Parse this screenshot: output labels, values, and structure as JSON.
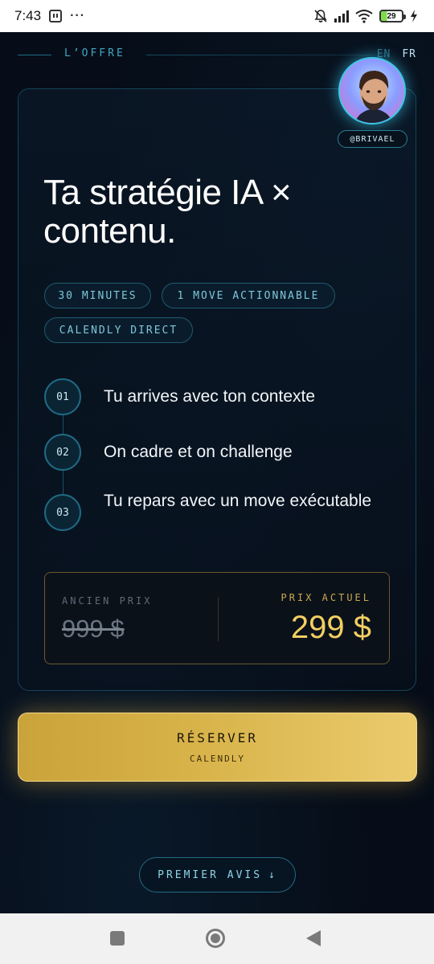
{
  "status_bar": {
    "time": "7:43",
    "dots": "···",
    "battery_level": "29",
    "icons": [
      "twitch-icon",
      "bell-off-icon",
      "signal-icon",
      "wifi-icon",
      "battery-icon",
      "charging-icon"
    ]
  },
  "header": {
    "section_label": "L’OFFRE",
    "lang_en": "EN",
    "lang_fr": "FR",
    "handle": "@BRIVAEL"
  },
  "offer": {
    "title": "Ta stratégie IA × contenu.",
    "tags": [
      "30 MINUTES",
      "1 MOVE ACTIONNABLE",
      "CALENDLY DIRECT"
    ],
    "steps": [
      {
        "num": "01",
        "text": "Tu arrives avec ton contexte"
      },
      {
        "num": "02",
        "text": "On cadre et on challenge"
      },
      {
        "num": "03",
        "text": "Tu repars avec un move exécutable"
      }
    ],
    "price": {
      "old_label": "ANCIEN PRIX",
      "old_value": "999 $",
      "current_label": "PRIX ACTUEL",
      "current_value": "299 $"
    }
  },
  "cta": {
    "reserve_label": "RÉSERVER",
    "reserve_sub": "CALENDLY",
    "avis_label": "PREMIER AVIS",
    "avis_arrow": "↓"
  },
  "colors": {
    "accent_cyan": "#3fa7c2",
    "gold": "#f2cf62",
    "background": "#060d18"
  }
}
